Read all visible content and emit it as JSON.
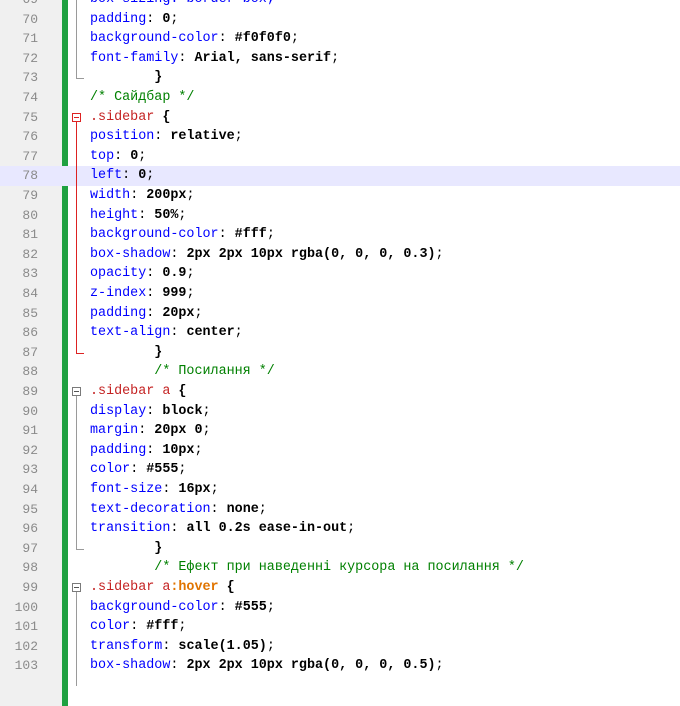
{
  "editor": {
    "current_line": 78,
    "lines": [
      {
        "num": "69",
        "tokens": [
          {
            "t": "box-sizing: border-box;",
            "c": "prop"
          }
        ]
      },
      {
        "num": "70",
        "tokens": [
          {
            "t": "padding",
            "c": "prop"
          },
          {
            "t": ": ",
            "c": "punct"
          },
          {
            "t": "0",
            "c": "val"
          },
          {
            "t": ";",
            "c": "punct"
          }
        ]
      },
      {
        "num": "71",
        "tokens": [
          {
            "t": "background-color",
            "c": "prop"
          },
          {
            "t": ": ",
            "c": "punct"
          },
          {
            "t": "#f0f0f0",
            "c": "val"
          },
          {
            "t": ";",
            "c": "punct"
          }
        ]
      },
      {
        "num": "72",
        "tokens": [
          {
            "t": "font-family",
            "c": "prop"
          },
          {
            "t": ": ",
            "c": "punct"
          },
          {
            "t": "Arial, sans-serif",
            "c": "val"
          },
          {
            "t": ";",
            "c": "punct"
          }
        ]
      },
      {
        "num": "73",
        "tokens": [
          {
            "t": "        }",
            "c": "brace"
          }
        ]
      },
      {
        "num": "74",
        "tokens": [
          {
            "t": "/* Сайдбар */",
            "c": "comment"
          }
        ]
      },
      {
        "num": "75",
        "tokens": [
          {
            "t": ".sidebar",
            "c": "sel"
          },
          {
            "t": " {",
            "c": "brace"
          }
        ]
      },
      {
        "num": "76",
        "tokens": [
          {
            "t": "position",
            "c": "prop"
          },
          {
            "t": ": ",
            "c": "punct"
          },
          {
            "t": "relative",
            "c": "val"
          },
          {
            "t": ";",
            "c": "punct"
          }
        ]
      },
      {
        "num": "77",
        "tokens": [
          {
            "t": "top",
            "c": "prop"
          },
          {
            "t": ": ",
            "c": "punct"
          },
          {
            "t": "0",
            "c": "val"
          },
          {
            "t": ";",
            "c": "punct"
          }
        ]
      },
      {
        "num": "78",
        "tokens": [
          {
            "t": "left",
            "c": "prop"
          },
          {
            "t": ": ",
            "c": "punct"
          },
          {
            "t": "0",
            "c": "val"
          },
          {
            "t": ";",
            "c": "punct"
          }
        ]
      },
      {
        "num": "79",
        "tokens": [
          {
            "t": "width",
            "c": "prop"
          },
          {
            "t": ": ",
            "c": "punct"
          },
          {
            "t": "200px",
            "c": "val"
          },
          {
            "t": ";",
            "c": "punct"
          }
        ]
      },
      {
        "num": "80",
        "tokens": [
          {
            "t": "height",
            "c": "prop"
          },
          {
            "t": ": ",
            "c": "punct"
          },
          {
            "t": "50%",
            "c": "val"
          },
          {
            "t": ";",
            "c": "punct"
          }
        ]
      },
      {
        "num": "81",
        "tokens": [
          {
            "t": "background-color",
            "c": "prop"
          },
          {
            "t": ": ",
            "c": "punct"
          },
          {
            "t": "#fff",
            "c": "val"
          },
          {
            "t": ";",
            "c": "punct"
          }
        ]
      },
      {
        "num": "82",
        "tokens": [
          {
            "t": "box-shadow",
            "c": "prop"
          },
          {
            "t": ": ",
            "c": "punct"
          },
          {
            "t": "2px 2px 10px rgba(0, 0, 0, 0.3)",
            "c": "val"
          },
          {
            "t": ";",
            "c": "punct"
          }
        ]
      },
      {
        "num": "83",
        "tokens": [
          {
            "t": "opacity",
            "c": "prop"
          },
          {
            "t": ": ",
            "c": "punct"
          },
          {
            "t": "0.9",
            "c": "val"
          },
          {
            "t": ";",
            "c": "punct"
          }
        ]
      },
      {
        "num": "84",
        "tokens": [
          {
            "t": "z-index",
            "c": "prop"
          },
          {
            "t": ": ",
            "c": "punct"
          },
          {
            "t": "999",
            "c": "val"
          },
          {
            "t": ";",
            "c": "punct"
          }
        ]
      },
      {
        "num": "85",
        "tokens": [
          {
            "t": "padding",
            "c": "prop"
          },
          {
            "t": ": ",
            "c": "punct"
          },
          {
            "t": "20px",
            "c": "val"
          },
          {
            "t": ";",
            "c": "punct"
          }
        ]
      },
      {
        "num": "86",
        "tokens": [
          {
            "t": "text-align",
            "c": "prop"
          },
          {
            "t": ": ",
            "c": "punct"
          },
          {
            "t": "center",
            "c": "val"
          },
          {
            "t": ";",
            "c": "punct"
          }
        ]
      },
      {
        "num": "87",
        "tokens": [
          {
            "t": "        }",
            "c": "brace"
          }
        ]
      },
      {
        "num": "88",
        "tokens": [
          {
            "t": "        /* Посилання */",
            "c": "comment"
          }
        ]
      },
      {
        "num": "89",
        "tokens": [
          {
            "t": ".sidebar a",
            "c": "sel"
          },
          {
            "t": " {",
            "c": "brace"
          }
        ]
      },
      {
        "num": "90",
        "tokens": [
          {
            "t": "display",
            "c": "prop"
          },
          {
            "t": ": ",
            "c": "punct"
          },
          {
            "t": "block",
            "c": "val"
          },
          {
            "t": ";",
            "c": "punct"
          }
        ]
      },
      {
        "num": "91",
        "tokens": [
          {
            "t": "margin",
            "c": "prop"
          },
          {
            "t": ": ",
            "c": "punct"
          },
          {
            "t": "20px 0",
            "c": "val"
          },
          {
            "t": ";",
            "c": "punct"
          }
        ]
      },
      {
        "num": "92",
        "tokens": [
          {
            "t": "padding",
            "c": "prop"
          },
          {
            "t": ": ",
            "c": "punct"
          },
          {
            "t": "10px",
            "c": "val"
          },
          {
            "t": ";",
            "c": "punct"
          }
        ]
      },
      {
        "num": "93",
        "tokens": [
          {
            "t": "color",
            "c": "prop"
          },
          {
            "t": ": ",
            "c": "punct"
          },
          {
            "t": "#555",
            "c": "val"
          },
          {
            "t": ";",
            "c": "punct"
          }
        ]
      },
      {
        "num": "94",
        "tokens": [
          {
            "t": "font-size",
            "c": "prop"
          },
          {
            "t": ": ",
            "c": "punct"
          },
          {
            "t": "16px",
            "c": "val"
          },
          {
            "t": ";",
            "c": "punct"
          }
        ]
      },
      {
        "num": "95",
        "tokens": [
          {
            "t": "text-decoration",
            "c": "prop"
          },
          {
            "t": ": ",
            "c": "punct"
          },
          {
            "t": "none",
            "c": "val"
          },
          {
            "t": ";",
            "c": "punct"
          }
        ]
      },
      {
        "num": "96",
        "tokens": [
          {
            "t": "transition",
            "c": "prop"
          },
          {
            "t": ": ",
            "c": "punct"
          },
          {
            "t": "all 0.2s ease-in-out",
            "c": "val"
          },
          {
            "t": ";",
            "c": "punct"
          }
        ]
      },
      {
        "num": "97",
        "tokens": [
          {
            "t": "        }",
            "c": "brace"
          }
        ]
      },
      {
        "num": "98",
        "tokens": [
          {
            "t": "        /* Ефект при наведенні курсора на посилання */",
            "c": "comment"
          }
        ]
      },
      {
        "num": "99",
        "tokens": [
          {
            "t": ".sidebar a",
            "c": "sel"
          },
          {
            "t": ":hover",
            "c": "pseudo"
          },
          {
            "t": " {",
            "c": "brace"
          }
        ]
      },
      {
        "num": "100",
        "tokens": [
          {
            "t": "background-color",
            "c": "prop"
          },
          {
            "t": ": ",
            "c": "punct"
          },
          {
            "t": "#555",
            "c": "val"
          },
          {
            "t": ";",
            "c": "punct"
          }
        ]
      },
      {
        "num": "101",
        "tokens": [
          {
            "t": "color",
            "c": "prop"
          },
          {
            "t": ": ",
            "c": "punct"
          },
          {
            "t": "#fff",
            "c": "val"
          },
          {
            "t": ";",
            "c": "punct"
          }
        ]
      },
      {
        "num": "102",
        "tokens": [
          {
            "t": "transform",
            "c": "prop"
          },
          {
            "t": ": ",
            "c": "punct"
          },
          {
            "t": "scale(1.05)",
            "c": "val"
          },
          {
            "t": ";",
            "c": "punct"
          }
        ]
      },
      {
        "num": "103",
        "tokens": [
          {
            "t": "box-shadow",
            "c": "prop"
          },
          {
            "t": ": ",
            "c": "punct"
          },
          {
            "t": "2px 2px 10px rgba(0, 0, 0, 0.5)",
            "c": "val"
          },
          {
            "t": ";",
            "c": "punct"
          }
        ]
      }
    ]
  }
}
